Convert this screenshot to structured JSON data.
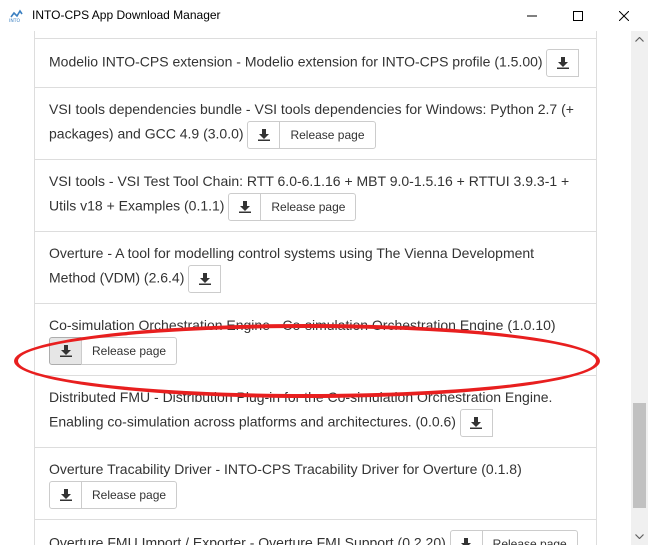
{
  "window": {
    "title": "INTO-CPS App Download Manager",
    "app_icon_name": "into-cps-logo-icon",
    "buttons": [
      "minimize-icon",
      "maximize-icon",
      "close-icon"
    ]
  },
  "items": [
    {
      "text": "",
      "download": false,
      "release": false
    },
    {
      "text": "Modelio INTO-CPS extension - Modelio extension for INTO-CPS profile (1.5.00)",
      "download": true,
      "release": false
    },
    {
      "text": "VSI tools dependencies bundle - VSI tools dependencies for Windows: Python 2.7 (+ packages) and GCC 4.9 (3.0.0)",
      "download": true,
      "release": true
    },
    {
      "text": "VSI tools - VSI Test Tool Chain: RTT 6.0-6.1.16 + MBT 9.0-1.5.16 + RTTUI 3.9.3-1 + Utils v18 + Examples (0.1.1)",
      "download": true,
      "release": true
    },
    {
      "text": "Overture - A tool for modelling control systems using The Vienna Development Method (VDM) (2.6.4)",
      "download": true,
      "release": false
    },
    {
      "text": "Co-simulation Orchestration Engine - Co-simulation Orchestration Engine (1.0.10)",
      "download": true,
      "release": true,
      "active": true
    },
    {
      "text": "Distributed FMU - Distribution Plug-in for the Co-simulation Orchestration Engine. Enabling co-simulation across platforms and architectures. (0.0.6)",
      "download": true,
      "release": false
    },
    {
      "text": "Overture Tracability Driver - INTO-CPS Tracability Driver for Overture (0.1.8)",
      "download": true,
      "release": true
    },
    {
      "text": "Overture FMU Import / Exporter - Overture FMI Support (0.2.20)",
      "download": true,
      "release": true
    }
  ],
  "labels": {
    "release_page": "Release page",
    "download_icon": "download-icon"
  },
  "colors": {
    "highlight": "#e81f1f",
    "border": "#dddddd",
    "text": "#333333"
  }
}
